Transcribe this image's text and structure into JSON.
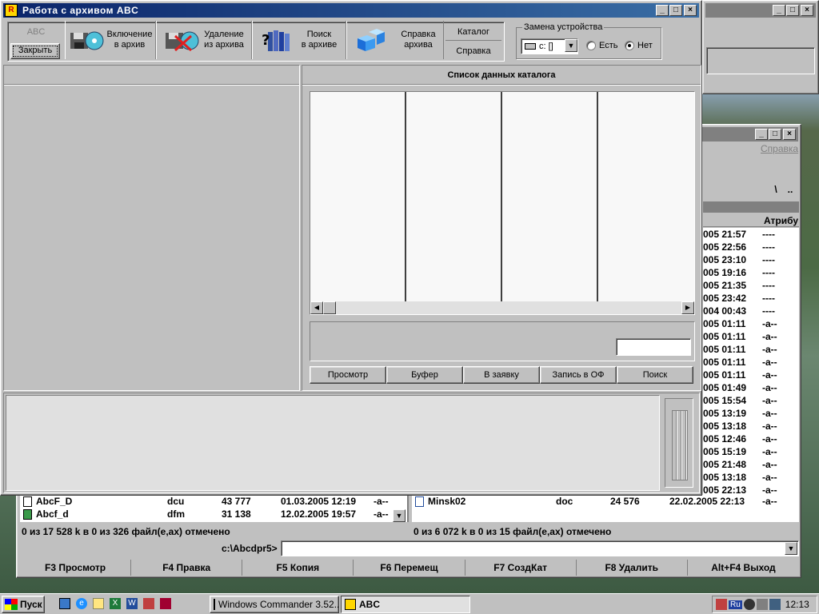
{
  "abc_window": {
    "title": "Работа с архивом ABC",
    "toolbar": {
      "abc_label": "ABC",
      "close_label": "Закрыть",
      "include_label": "Включение\nв архив",
      "delete_label": "Удаление\nиз архива",
      "search_label": "Поиск\nв архиве",
      "help_archive_label": "Справка\nархива",
      "catalog_label": "Каталог",
      "help_label": "Справка"
    },
    "device": {
      "group_label": "Замена устройства",
      "drive_value": "c: []",
      "yes_label": "Есть",
      "no_label": "Нет",
      "selected": "no"
    },
    "catalog_header": "Список данных каталога",
    "buttons": {
      "view": "Просмотр",
      "buffer": "Буфер",
      "to_request": "В заявку",
      "write_of": "Запись в ОФ",
      "search": "Поиск"
    }
  },
  "wc_window": {
    "menu_help": "Справка",
    "path_buttons": [
      "\\",
      ".."
    ],
    "attr_header": "Атрибу",
    "right_rows": [
      {
        "date": "005 21:57",
        "attr": "----"
      },
      {
        "date": "005 22:56",
        "attr": "----"
      },
      {
        "date": "005 23:10",
        "attr": "----"
      },
      {
        "date": "005 19:16",
        "attr": "----"
      },
      {
        "date": "005 21:35",
        "attr": "----"
      },
      {
        "date": "005 23:42",
        "attr": "----"
      },
      {
        "date": "004 00:43",
        "attr": "----"
      },
      {
        "date": "005 01:11",
        "attr": "-a--"
      },
      {
        "date": "005 01:11",
        "attr": "-a--"
      },
      {
        "date": "005 01:11",
        "attr": "-a--"
      },
      {
        "date": "005 01:11",
        "attr": "-a--"
      },
      {
        "date": "005 01:11",
        "attr": "-a--"
      },
      {
        "date": "005 01:49",
        "attr": "-a--"
      },
      {
        "date": "005 15:54",
        "attr": "-a--"
      },
      {
        "date": "005 13:19",
        "attr": "-a--"
      },
      {
        "date": "005 13:18",
        "attr": "-a--"
      },
      {
        "date": "005 12:46",
        "attr": "-a--"
      },
      {
        "date": "005 15:19",
        "attr": "-a--"
      },
      {
        "date": "005 21:48",
        "attr": "-a--"
      },
      {
        "date": "005 13:18",
        "attr": "-a--"
      },
      {
        "date": "005 22:13",
        "attr": "-a--"
      }
    ],
    "left_files": [
      {
        "name": "AbcF_D",
        "ext": "dcu",
        "size": "43 777",
        "date": "01.03.2005 12:19",
        "attr": "-a--"
      },
      {
        "name": "Abcf_d",
        "ext": "dfm",
        "size": "31 138",
        "date": "12.02.2005 19:57",
        "attr": "-a--"
      }
    ],
    "right_file": {
      "name": "Minsk02",
      "ext": "doc",
      "size": "24 576",
      "date": "22.02.2005 22:13",
      "attr": "-a--"
    },
    "left_status": "0 из 17 528 k в 0 из 326 файл(е,ах) отмечено",
    "right_status": "0 из 6 072 k в 0 из 15 файл(е,ах) отмечено",
    "cmd_path": "c:\\Abcdpr5>",
    "fkeys": [
      "F3 Просмотр",
      "F4 Правка",
      "F5 Копия",
      "F6 Перемещ",
      "F7 СоздКат",
      "F8 Удалить",
      "Alt+F4 Выход"
    ]
  },
  "taskbar": {
    "start_label": "Пуск",
    "task1": "Windows Commander 3.52...",
    "task2": "ABC",
    "lang": "Ru",
    "clock": "12:13"
  },
  "colors": {
    "title_active": "#0a246a",
    "face": "#c0c0c0"
  }
}
